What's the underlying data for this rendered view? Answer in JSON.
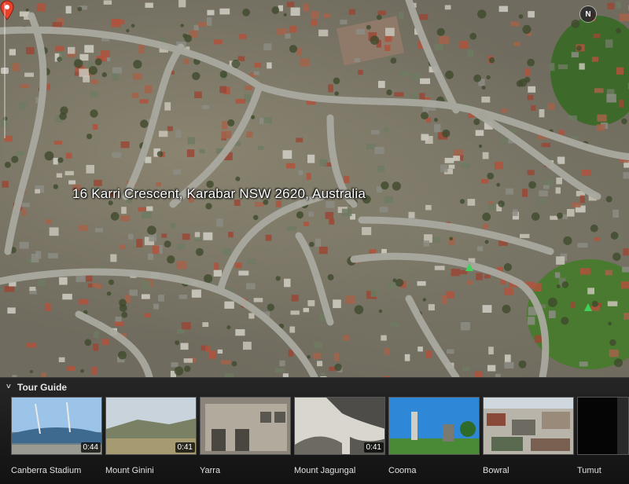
{
  "map": {
    "address": "16 Karri Crescent, Karabar NSW 2620, Australia",
    "compass_label": "N",
    "accent_color": "#e8412c",
    "icons": [
      "place-pin-icon",
      "tree-marker-icon",
      "compass-icon",
      "zoom-slider"
    ]
  },
  "tour_guide": {
    "title": "Tour Guide",
    "items": [
      {
        "name": "Canberra Stadium",
        "duration": "0:44",
        "icon": "stadium-thumbnail"
      },
      {
        "name": "Mount Ginini",
        "duration": "0:41",
        "icon": "mountain-thumbnail"
      },
      {
        "name": "Yarra",
        "duration": "",
        "icon": "building-thumbnail"
      },
      {
        "name": "Mount Jagungal",
        "duration": "0:41",
        "icon": "snow-mountain-thumbnail"
      },
      {
        "name": "Cooma",
        "duration": "",
        "icon": "memorial-thumbnail"
      },
      {
        "name": "Bowral",
        "duration": "",
        "icon": "town-thumbnail"
      },
      {
        "name": "Tumut",
        "duration": "",
        "icon": "dark-thumbnail"
      }
    ]
  }
}
